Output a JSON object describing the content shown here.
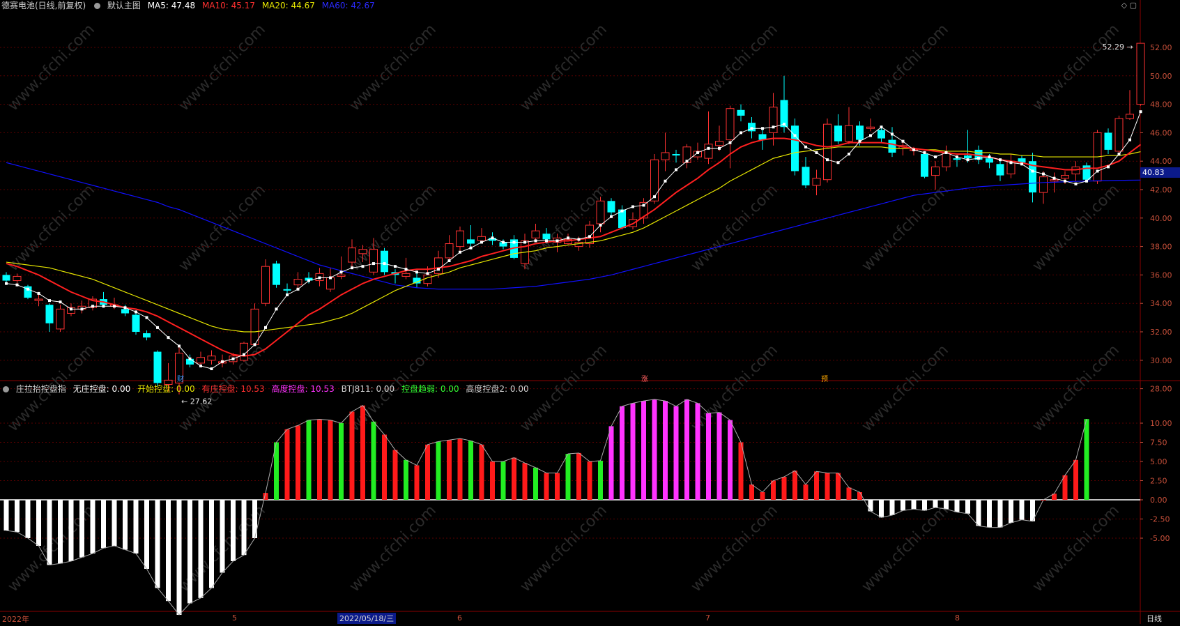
{
  "main_header": {
    "stock": "德赛电池(日线,前复权)",
    "chart_name": "默认主图",
    "ma5": "MA5: 47.48",
    "ma10": "MA10: 45.17",
    "ma20": "MA20: 44.67",
    "ma60": "MA60: 42.67"
  },
  "indicator_header": {
    "name": "庄拉抬控盘指",
    "wu": "无庄控盘: 0.00",
    "kaishi": "开始控盘: 0.00",
    "you": "有庄控盘: 10.53",
    "gaodu": "高度控盘: 10.53",
    "btj": "BTJ811: 0.00",
    "ruo": "控盘趋弱: 0.00",
    "gaodu2": "高度控盘2: 0.00"
  },
  "price_axis": [
    "52.00",
    "50.00",
    "48.00",
    "46.00",
    "44.00",
    "42.00",
    "40.00",
    "38.00",
    "36.00",
    "34.00",
    "32.00",
    "30.00",
    "28.00"
  ],
  "ind_axis": [
    "10.00",
    "7.50",
    "5.00",
    "2.50",
    "0.00",
    "-2.50",
    "-5.00"
  ],
  "current_price": "40.83",
  "high_label": "52.29",
  "low_label": "27.62",
  "markers": {
    "cai": "财",
    "zhang": "涨",
    "yu": "预"
  },
  "dates": {
    "year": "2022年",
    "m5": "5",
    "m6": "6",
    "m7": "7",
    "m8": "8",
    "cursor": "2022/05/18/三"
  },
  "period": "日线",
  "watermark": "www.cfchi.com",
  "colors": {
    "up": "#ff3232",
    "down": "#00ffff",
    "ma5": "#ffffff",
    "ma10": "#ff2020",
    "ma20": "#e6e600",
    "ma60": "#1010ff"
  },
  "chart_data": [
    {
      "type": "candlestick",
      "title": "德赛电池(日线,前复权)",
      "ylim": [
        27,
        53
      ],
      "candles": [
        [
          36.0,
          35.6,
          36.2,
          35.3
        ],
        [
          35.6,
          35.9,
          36.1,
          35.4
        ],
        [
          35.2,
          34.4,
          35.3,
          34.3
        ],
        [
          34.2,
          34.3,
          34.8,
          33.8
        ],
        [
          33.9,
          32.6,
          34.0,
          32.0
        ],
        [
          32.2,
          33.6,
          33.9,
          32.0
        ],
        [
          33.3,
          33.7,
          34.0,
          33.1
        ],
        [
          33.6,
          33.8,
          34.2,
          33.3
        ],
        [
          33.7,
          34.3,
          34.5,
          33.5
        ],
        [
          34.3,
          33.9,
          34.8,
          33.7
        ],
        [
          33.8,
          33.9,
          34.4,
          33.6
        ],
        [
          33.6,
          33.3,
          33.9,
          33.1
        ],
        [
          33.2,
          32.0,
          33.4,
          31.8
        ],
        [
          31.9,
          31.6,
          32.1,
          31.4
        ],
        [
          30.6,
          28.4,
          30.7,
          28.2
        ],
        [
          28.3,
          28.6,
          29.8,
          27.8
        ],
        [
          28.4,
          30.5,
          30.9,
          27.6
        ],
        [
          30.1,
          29.7,
          30.4,
          29.5
        ],
        [
          29.8,
          30.2,
          30.6,
          29.6
        ],
        [
          30.0,
          30.3,
          30.7,
          29.7
        ],
        [
          29.8,
          29.9,
          30.4,
          29.5
        ],
        [
          29.9,
          30.3,
          30.5,
          29.7
        ],
        [
          30.0,
          31.2,
          31.3,
          29.9
        ],
        [
          31.1,
          33.6,
          34.0,
          31.0
        ],
        [
          34.0,
          36.6,
          37.1,
          33.8
        ],
        [
          36.8,
          35.3,
          37.0,
          35.1
        ],
        [
          35.0,
          34.9,
          35.4,
          34.6
        ],
        [
          35.3,
          35.7,
          36.2,
          35.0
        ],
        [
          35.8,
          35.6,
          36.2,
          35.4
        ],
        [
          35.6,
          36.1,
          36.5,
          35.2
        ],
        [
          35.0,
          35.8,
          36.5,
          34.8
        ],
        [
          35.9,
          36.0,
          37.3,
          35.7
        ],
        [
          36.9,
          37.9,
          38.5,
          36.5
        ],
        [
          37.5,
          37.8,
          38.1,
          36.9
        ],
        [
          36.2,
          37.8,
          38.6,
          36.0
        ],
        [
          37.7,
          36.2,
          37.9,
          36.0
        ],
        [
          36.2,
          36.0,
          36.4,
          35.4
        ],
        [
          35.9,
          36.1,
          37.2,
          35.7
        ],
        [
          35.8,
          35.4,
          36.3,
          35.1
        ],
        [
          35.4,
          36.0,
          36.6,
          35.2
        ],
        [
          36.1,
          37.2,
          37.7,
          35.8
        ],
        [
          37.2,
          38.2,
          38.8,
          37.0
        ],
        [
          38.0,
          39.1,
          39.4,
          37.7
        ],
        [
          38.5,
          38.2,
          39.5,
          38.0
        ],
        [
          38.4,
          38.7,
          39.3,
          38.2
        ],
        [
          38.6,
          38.4,
          39.0,
          38.1
        ],
        [
          38.3,
          38.0,
          38.5,
          37.8
        ],
        [
          38.5,
          37.2,
          38.8,
          37.1
        ],
        [
          36.8,
          38.4,
          38.9,
          36.4
        ],
        [
          38.6,
          39.1,
          39.6,
          38.3
        ],
        [
          38.9,
          38.5,
          39.3,
          38.2
        ],
        [
          38.3,
          38.6,
          38.9,
          37.6
        ],
        [
          38.2,
          38.5,
          38.9,
          38.1
        ],
        [
          38.0,
          38.3,
          38.7,
          37.7
        ],
        [
          38.2,
          39.5,
          39.8,
          37.9
        ],
        [
          39.6,
          41.2,
          41.5,
          39.0
        ],
        [
          41.2,
          40.4,
          41.4,
          40.1
        ],
        [
          40.6,
          39.3,
          40.9,
          39.2
        ],
        [
          39.4,
          39.9,
          40.4,
          39.2
        ],
        [
          40.0,
          41.1,
          41.4,
          39.6
        ],
        [
          41.2,
          44.1,
          44.5,
          41.0
        ],
        [
          44.1,
          44.6,
          46.0,
          43.3
        ],
        [
          44.5,
          44.4,
          44.8,
          43.9
        ],
        [
          43.9,
          45.0,
          45.2,
          43.5
        ],
        [
          44.3,
          44.7,
          45.3,
          44.1
        ],
        [
          44.2,
          45.2,
          47.5,
          43.8
        ],
        [
          45.1,
          45.4,
          46.5,
          44.7
        ],
        [
          45.5,
          47.7,
          47.9,
          43.5
        ],
        [
          47.6,
          47.2,
          48.0,
          46.8
        ],
        [
          46.7,
          46.1,
          47.1,
          45.6
        ],
        [
          45.9,
          45.5,
          46.4,
          44.8
        ],
        [
          46.0,
          47.8,
          48.8,
          45.1
        ],
        [
          48.3,
          46.4,
          50.0,
          46.0
        ],
        [
          46.5,
          43.3,
          47.0,
          43.0
        ],
        [
          43.6,
          42.3,
          44.3,
          42.1
        ],
        [
          42.3,
          42.8,
          43.4,
          41.6
        ],
        [
          42.7,
          46.6,
          47.0,
          42.5
        ],
        [
          46.5,
          45.4,
          47.3,
          45.2
        ],
        [
          45.4,
          46.5,
          47.8,
          45.2
        ],
        [
          46.5,
          45.5,
          46.8,
          45.1
        ],
        [
          46.3,
          46.4,
          47.0,
          46.1
        ],
        [
          46.2,
          45.6,
          46.5,
          45.3
        ],
        [
          45.5,
          44.6,
          46.4,
          44.3
        ],
        [
          44.9,
          45.1,
          45.4,
          44.4
        ],
        [
          44.8,
          44.8,
          45.0,
          44.4
        ],
        [
          44.5,
          42.9,
          44.7,
          42.8
        ],
        [
          43.0,
          43.6,
          44.0,
          42.0
        ],
        [
          43.6,
          44.6,
          45.1,
          43.3
        ],
        [
          44.2,
          44.1,
          44.4,
          43.6
        ],
        [
          44.4,
          44.2,
          46.2,
          43.9
        ],
        [
          44.8,
          44.1,
          45.1,
          43.8
        ],
        [
          44.2,
          43.9,
          44.5,
          43.5
        ],
        [
          43.8,
          43.0,
          44.1,
          42.6
        ],
        [
          43.1,
          44.0,
          44.5,
          42.8
        ],
        [
          44.2,
          43.9,
          44.4,
          43.7
        ],
        [
          44.0,
          41.8,
          44.6,
          41.1
        ],
        [
          41.8,
          42.9,
          43.3,
          41.0
        ],
        [
          42.6,
          42.7,
          43.2,
          41.8
        ],
        [
          42.8,
          43.0,
          43.3,
          42.4
        ],
        [
          43.1,
          43.6,
          44.0,
          42.6
        ],
        [
          43.7,
          42.7,
          43.9,
          42.5
        ],
        [
          42.6,
          46.0,
          46.2,
          42.4
        ],
        [
          46.0,
          44.8,
          46.3,
          44.5
        ],
        [
          44.7,
          47.0,
          47.2,
          44.6
        ],
        [
          47.0,
          47.3,
          49.0,
          46.9
        ],
        [
          48.0,
          52.29,
          52.3,
          47.9
        ]
      ],
      "ma5": [
        35.4,
        35.3,
        35.0,
        34.7,
        34.2,
        34.1,
        33.6,
        33.6,
        33.8,
        33.8,
        33.8,
        33.7,
        33.4,
        33.0,
        32.3,
        31.6,
        31.0,
        30.1,
        29.6,
        29.4,
        29.9,
        30.1,
        30.4,
        31.1,
        32.3,
        33.6,
        34.6,
        35.0,
        35.6,
        35.8,
        35.8,
        36.2,
        36.5,
        36.6,
        36.8,
        36.8,
        36.6,
        36.4,
        36.2,
        36.1,
        36.4,
        37.0,
        37.6,
        37.9,
        38.3,
        38.6,
        38.3,
        38.3,
        38.3,
        38.4,
        38.4,
        38.4,
        38.6,
        38.5,
        38.7,
        39.5,
        40.1,
        40.5,
        40.8,
        40.9,
        41.5,
        42.6,
        43.4,
        44.0,
        44.6,
        44.9,
        44.9,
        45.3,
        46.0,
        46.3,
        46.3,
        46.4,
        46.6,
        45.8,
        45.0,
        44.6,
        44.1,
        43.9,
        44.5,
        45.4,
        45.8,
        46.4,
        45.9,
        45.4,
        44.8,
        44.6,
        44.3,
        44.6,
        44.3,
        44.1,
        44.2,
        44.3,
        44.1,
        43.9,
        43.8,
        43.3,
        43.1,
        42.8,
        42.6,
        42.4,
        42.6,
        43.3,
        43.6,
        44.5,
        45.5,
        47.48
      ],
      "ma10": [
        36.8,
        36.6,
        36.3,
        36.0,
        35.6,
        35.2,
        34.8,
        34.5,
        34.2,
        34.1,
        33.9,
        33.7,
        33.6,
        33.4,
        33.1,
        32.7,
        32.3,
        31.9,
        31.5,
        31.1,
        30.7,
        30.4,
        30.3,
        30.4,
        30.8,
        31.4,
        32.0,
        32.6,
        33.2,
        33.6,
        34.1,
        34.6,
        35.0,
        35.4,
        35.7,
        35.9,
        36.1,
        36.3,
        36.4,
        36.4,
        36.5,
        36.6,
        36.8,
        37.0,
        37.3,
        37.5,
        37.7,
        37.9,
        38.0,
        38.2,
        38.3,
        38.4,
        38.4,
        38.5,
        38.6,
        38.7,
        39.0,
        39.3,
        39.6,
        40.1,
        40.6,
        41.2,
        41.8,
        42.3,
        42.8,
        43.4,
        43.9,
        44.5,
        45.0,
        45.3,
        45.5,
        45.6,
        45.6,
        45.5,
        45.3,
        45.1,
        45.0,
        45.1,
        45.3,
        45.3,
        45.3,
        45.3,
        45.2,
        45.0,
        44.9,
        44.8,
        44.7,
        44.6,
        44.5,
        44.5,
        44.4,
        44.3,
        44.1,
        44.0,
        43.9,
        43.7,
        43.6,
        43.5,
        43.4,
        43.4,
        43.5,
        43.5,
        43.7,
        44.0,
        44.6,
        45.17
      ],
      "ma20": [
        36.9,
        36.8,
        36.7,
        36.6,
        36.5,
        36.3,
        36.1,
        35.9,
        35.7,
        35.4,
        35.1,
        34.8,
        34.5,
        34.2,
        33.9,
        33.6,
        33.3,
        33.0,
        32.7,
        32.4,
        32.2,
        32.1,
        32.0,
        32.0,
        32.1,
        32.2,
        32.3,
        32.4,
        32.5,
        32.6,
        32.8,
        33.0,
        33.3,
        33.7,
        34.1,
        34.5,
        34.9,
        35.2,
        35.5,
        35.8,
        36.0,
        36.2,
        36.5,
        36.7,
        36.9,
        37.1,
        37.3,
        37.5,
        37.6,
        37.7,
        37.9,
        38.0,
        38.1,
        38.2,
        38.3,
        38.4,
        38.6,
        38.8,
        39.0,
        39.3,
        39.7,
        40.1,
        40.5,
        40.9,
        41.3,
        41.7,
        42.1,
        42.6,
        43.0,
        43.4,
        43.8,
        44.2,
        44.4,
        44.6,
        44.7,
        44.8,
        44.9,
        45.0,
        45.0,
        45.0,
        45.0,
        45.0,
        44.9,
        44.9,
        44.9,
        44.8,
        44.8,
        44.7,
        44.7,
        44.7,
        44.6,
        44.6,
        44.5,
        44.5,
        44.4,
        44.4,
        44.3,
        44.3,
        44.3,
        44.3,
        44.3,
        44.3,
        44.4,
        44.4,
        44.5,
        44.67
      ],
      "ma60": [
        43.9,
        43.7,
        43.5,
        43.3,
        43.1,
        42.9,
        42.7,
        42.5,
        42.3,
        42.1,
        41.9,
        41.7,
        41.5,
        41.3,
        41.1,
        40.8,
        40.6,
        40.3,
        40.0,
        39.7,
        39.4,
        39.1,
        38.8,
        38.5,
        38.2,
        37.9,
        37.6,
        37.3,
        37.0,
        36.7,
        36.5,
        36.3,
        36.1,
        35.9,
        35.7,
        35.5,
        35.3,
        35.2,
        35.1,
        35.05,
        35.0,
        35.0,
        35.0,
        35.0,
        35.0,
        35.0,
        35.05,
        35.1,
        35.15,
        35.2,
        35.3,
        35.4,
        35.5,
        35.6,
        35.7,
        35.85,
        36.0,
        36.2,
        36.4,
        36.6,
        36.8,
        37.0,
        37.2,
        37.4,
        37.6,
        37.8,
        38.0,
        38.2,
        38.4,
        38.6,
        38.8,
        39.0,
        39.2,
        39.4,
        39.6,
        39.8,
        40.0,
        40.2,
        40.4,
        40.6,
        40.8,
        41.0,
        41.2,
        41.4,
        41.6,
        41.7,
        41.8,
        41.9,
        42.0,
        42.1,
        42.2,
        42.25,
        42.3,
        42.35,
        42.4,
        42.45,
        42.5,
        42.52,
        42.55,
        42.58,
        42.6,
        42.62,
        42.63,
        42.65,
        42.66,
        42.67
      ]
    },
    {
      "type": "bar",
      "title": "庄拉抬控盘指",
      "ylim": [
        -14,
        14
      ],
      "series": [
        {
          "name": "有庄控盘",
          "values": [
            -4.0,
            -4.2,
            -5.0,
            -6.0,
            -8.5,
            -8.3,
            -8.0,
            -7.5,
            -7.0,
            -6.3,
            -6.0,
            -6.5,
            -7.0,
            -9.0,
            -11.5,
            -13.2,
            -15.0,
            -13.5,
            -12.8,
            -11.5,
            -9.5,
            -8.0,
            -7.2,
            -5.0,
            0.9,
            7.5,
            9.2,
            9.7,
            10.4,
            10.5,
            10.4,
            10.0,
            11.5,
            12.3,
            10.2,
            8.5,
            6.5,
            5.2,
            4.5,
            7.2,
            7.6,
            7.8,
            8.0,
            7.7,
            7.2,
            5.0,
            5.0,
            5.5,
            4.8,
            4.2,
            3.5,
            3.5,
            6.0,
            6.1,
            5.0,
            5.1,
            9.6,
            12.2,
            12.6,
            12.9,
            13.1,
            12.9,
            12.2,
            13.1,
            12.6,
            11.3,
            11.4,
            10.4,
            7.5,
            2.0,
            1.0,
            2.5,
            3.0,
            3.8,
            2.0,
            3.7,
            3.5,
            3.5,
            1.6,
            1.0,
            -1.5,
            -2.3,
            -2.0,
            -1.4,
            -1.2,
            -1.4,
            -1.0,
            -1.2,
            -1.6,
            -1.8,
            -3.4,
            -3.6,
            -3.6,
            -3.0,
            -2.6,
            -2.8,
            0.0,
            0.8,
            3.2,
            5.2,
            10.53
          ]
        }
      ]
    }
  ]
}
